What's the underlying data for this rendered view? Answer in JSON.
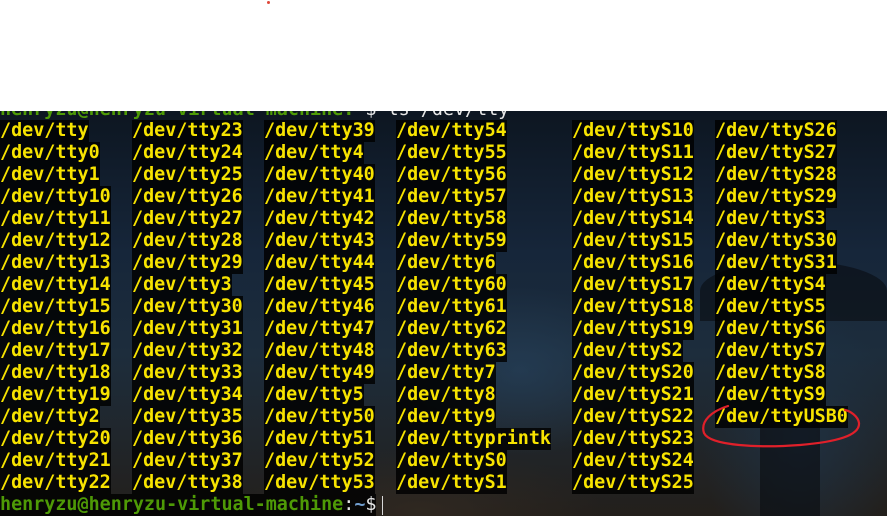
{
  "terminal": {
    "command_line": {
      "user_host": "henryzu@henryzu-virtual-machine",
      "colon": ":",
      "path": "~",
      "symbol": "$",
      "command": " ls /dev/tty"
    },
    "columns": [
      [
        "/dev/tty",
        "/dev/tty0",
        "/dev/tty1",
        "/dev/tty10",
        "/dev/tty11",
        "/dev/tty12",
        "/dev/tty13",
        "/dev/tty14",
        "/dev/tty15",
        "/dev/tty16",
        "/dev/tty17",
        "/dev/tty18",
        "/dev/tty19",
        "/dev/tty2",
        "/dev/tty20",
        "/dev/tty21",
        "/dev/tty22"
      ],
      [
        "/dev/tty23",
        "/dev/tty24",
        "/dev/tty25",
        "/dev/tty26",
        "/dev/tty27",
        "/dev/tty28",
        "/dev/tty29",
        "/dev/tty3",
        "/dev/tty30",
        "/dev/tty31",
        "/dev/tty32",
        "/dev/tty33",
        "/dev/tty34",
        "/dev/tty35",
        "/dev/tty36",
        "/dev/tty37",
        "/dev/tty38"
      ],
      [
        "/dev/tty39",
        "/dev/tty4",
        "/dev/tty40",
        "/dev/tty41",
        "/dev/tty42",
        "/dev/tty43",
        "/dev/tty44",
        "/dev/tty45",
        "/dev/tty46",
        "/dev/tty47",
        "/dev/tty48",
        "/dev/tty49",
        "/dev/tty5",
        "/dev/tty50",
        "/dev/tty51",
        "/dev/tty52",
        "/dev/tty53"
      ],
      [
        "/dev/tty54",
        "/dev/tty55",
        "/dev/tty56",
        "/dev/tty57",
        "/dev/tty58",
        "/dev/tty59",
        "/dev/tty6",
        "/dev/tty60",
        "/dev/tty61",
        "/dev/tty62",
        "/dev/tty63",
        "/dev/tty7",
        "/dev/tty8",
        "/dev/tty9",
        "/dev/ttyprintk",
        "/dev/ttyS0",
        "/dev/ttyS1"
      ],
      [
        "/dev/ttyS10",
        "/dev/ttyS11",
        "/dev/ttyS12",
        "/dev/ttyS13",
        "/dev/ttyS14",
        "/dev/ttyS15",
        "/dev/ttyS16",
        "/dev/ttyS17",
        "/dev/ttyS18",
        "/dev/ttyS19",
        "/dev/ttyS2",
        "/dev/ttyS20",
        "/dev/ttyS21",
        "/dev/ttyS22",
        "/dev/ttyS23",
        "/dev/ttyS24",
        "/dev/ttyS25"
      ],
      [
        "/dev/ttyS26",
        "/dev/ttyS27",
        "/dev/ttyS28",
        "/dev/ttyS29",
        "/dev/ttyS3",
        "/dev/ttyS30",
        "/dev/ttyS31",
        "/dev/ttyS4",
        "/dev/ttyS5",
        "/dev/ttyS6",
        "/dev/ttyS7",
        "/dev/ttyS8",
        "/dev/ttyS9",
        "/dev/ttyUSB0"
      ]
    ],
    "prompt": {
      "user_host": "henryzu@henryzu-virtual-machine",
      "colon": ":",
      "path": "~",
      "symbol": "$"
    },
    "colors": {
      "output_text": "#f7e300",
      "prompt_user": "#4e9a06",
      "prompt_path": "#729fcf",
      "annotation_circle": "#e0202a"
    }
  }
}
